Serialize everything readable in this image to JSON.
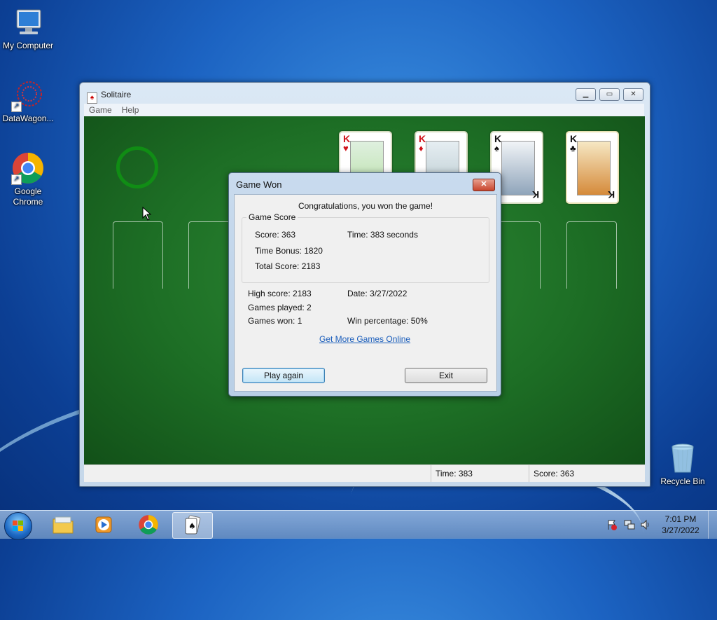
{
  "desktop": {
    "icons": [
      {
        "label": "My Computer",
        "icon": "computer-icon"
      },
      {
        "label": "DataWagon...",
        "icon": "datawagon-icon"
      },
      {
        "label": "Google Chrome",
        "icon": "chrome-icon"
      },
      {
        "label": "Recycle Bin",
        "icon": "recycle-bin-icon"
      }
    ]
  },
  "window": {
    "title": "Solitaire",
    "menu": [
      "Game",
      "Help"
    ],
    "status": {
      "time": "Time:  383",
      "score": "Score: 363"
    }
  },
  "foundation_cards": [
    {
      "rank": "K",
      "suit": "♥",
      "color": "red"
    },
    {
      "rank": "K",
      "suit": "♦",
      "color": "red"
    },
    {
      "rank": "K",
      "suit": "♠",
      "color": "black"
    },
    {
      "rank": "K",
      "suit": "♣",
      "color": "black"
    }
  ],
  "dialog": {
    "title": "Game Won",
    "message": "Congratulations, you won the game!",
    "group_label": "Game Score",
    "score": "Score: 363",
    "time": "Time:  383 seconds",
    "time_bonus": "Time Bonus: 1820",
    "total_score": "Total Score: 2183",
    "high_score": "High score: 2183",
    "date": "Date: 3/27/2022",
    "games_played": "Games played: 2",
    "games_won": "Games won: 1",
    "win_percentage": "Win percentage: 50%",
    "link": "Get More Games Online",
    "play_again": "Play again",
    "exit": "Exit"
  },
  "taskbar": {
    "clock_time": "7:01 PM",
    "clock_date": "3/27/2022"
  }
}
